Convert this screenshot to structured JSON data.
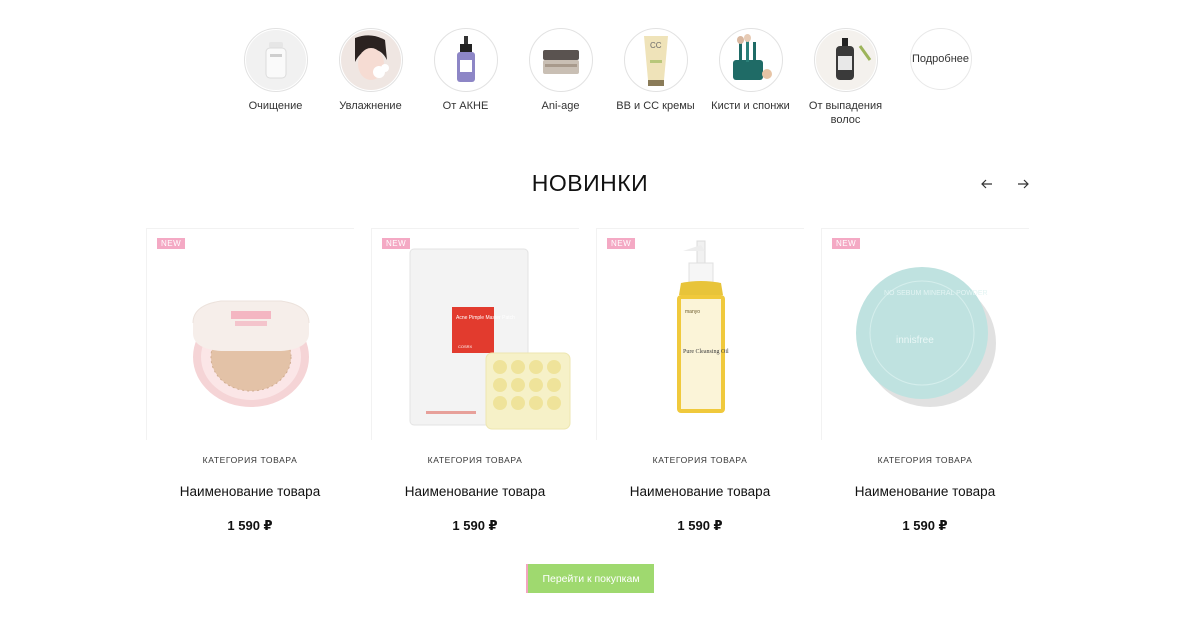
{
  "categories": [
    {
      "label": "Очищение",
      "icon": "cleanser-bottle-icon"
    },
    {
      "label": "Увлажнение",
      "icon": "face-mask-woman-icon"
    },
    {
      "label": "От АКНЕ",
      "icon": "serum-dropper-icon"
    },
    {
      "label": "Ani-age",
      "icon": "cream-jar-icon"
    },
    {
      "label": "BB и CC кремы",
      "icon": "cc-cream-tube-icon"
    },
    {
      "label": "Кисти и спонжи",
      "icon": "brushes-icon"
    },
    {
      "label": "От выпадения волос",
      "icon": "shampoo-bottle-icon"
    }
  ],
  "more_label": "Подробнее",
  "section_title": "НОВИНКИ",
  "products": [
    {
      "badge": "NEW",
      "category": "КАТЕГОРИЯ ТОВАРА",
      "name": "Наименование товара",
      "price": "1 590 ₽",
      "image": "cushion-compact"
    },
    {
      "badge": "NEW",
      "category": "КАТЕГОРИЯ ТОВАРА",
      "name": "Наименование товара",
      "price": "1 590 ₽",
      "image": "acne-patch"
    },
    {
      "badge": "NEW",
      "category": "КАТЕГОРИЯ ТОВАРА",
      "name": "Наименование товара",
      "price": "1 590 ₽",
      "image": "cleansing-oil"
    },
    {
      "badge": "NEW",
      "category": "КАТЕГОРИЯ ТОВАРА",
      "name": "Наименование товара",
      "price": "1 590 ₽",
      "image": "powder-compact"
    }
  ],
  "product_texts": {
    "patch_title": "Acne Pimple Master Patch",
    "patch_brand": "COSRX",
    "oil_brand": "manyo",
    "oil_title": "Pure Cleansing Oil",
    "compact_brand": "innisfree",
    "compact_ring": "NO SEBUM MINERAL POWDER",
    "cc_label": "CC"
  },
  "cta_label": "Перейти к покупкам",
  "colors": {
    "badge": "#f4a9c4",
    "cta": "#9fd96f",
    "cta_border": "#f3a3c0"
  }
}
